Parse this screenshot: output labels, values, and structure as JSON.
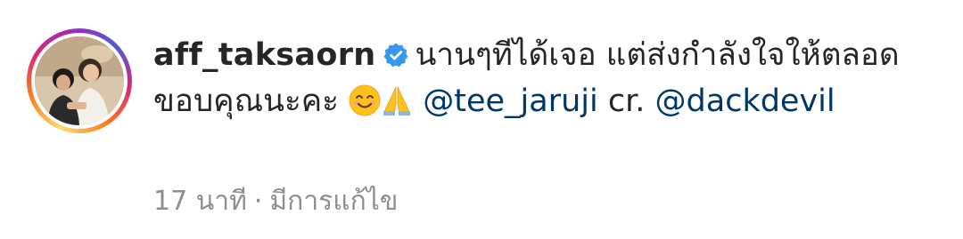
{
  "comment": {
    "username": "aff_taksaorn",
    "caption_part1": "นานๆทีได้เจอ แต่ส่งกำลังใจให้ตลอด ขอบคุณนะคะ ",
    "mention_1": "@tee_jaruji",
    "caption_part2": "  cr. ",
    "mention_2": "@dackdevil",
    "emojis": [
      "smiling-face-emoji",
      "folded-hands-emoji"
    ],
    "time": "17 นาที",
    "separator": "·",
    "edited_label": "มีการแก้ไข"
  },
  "colors": {
    "username": "#262626",
    "mention": "#00376b",
    "meta": "#8e8e8e",
    "verified": "#3897f0"
  }
}
